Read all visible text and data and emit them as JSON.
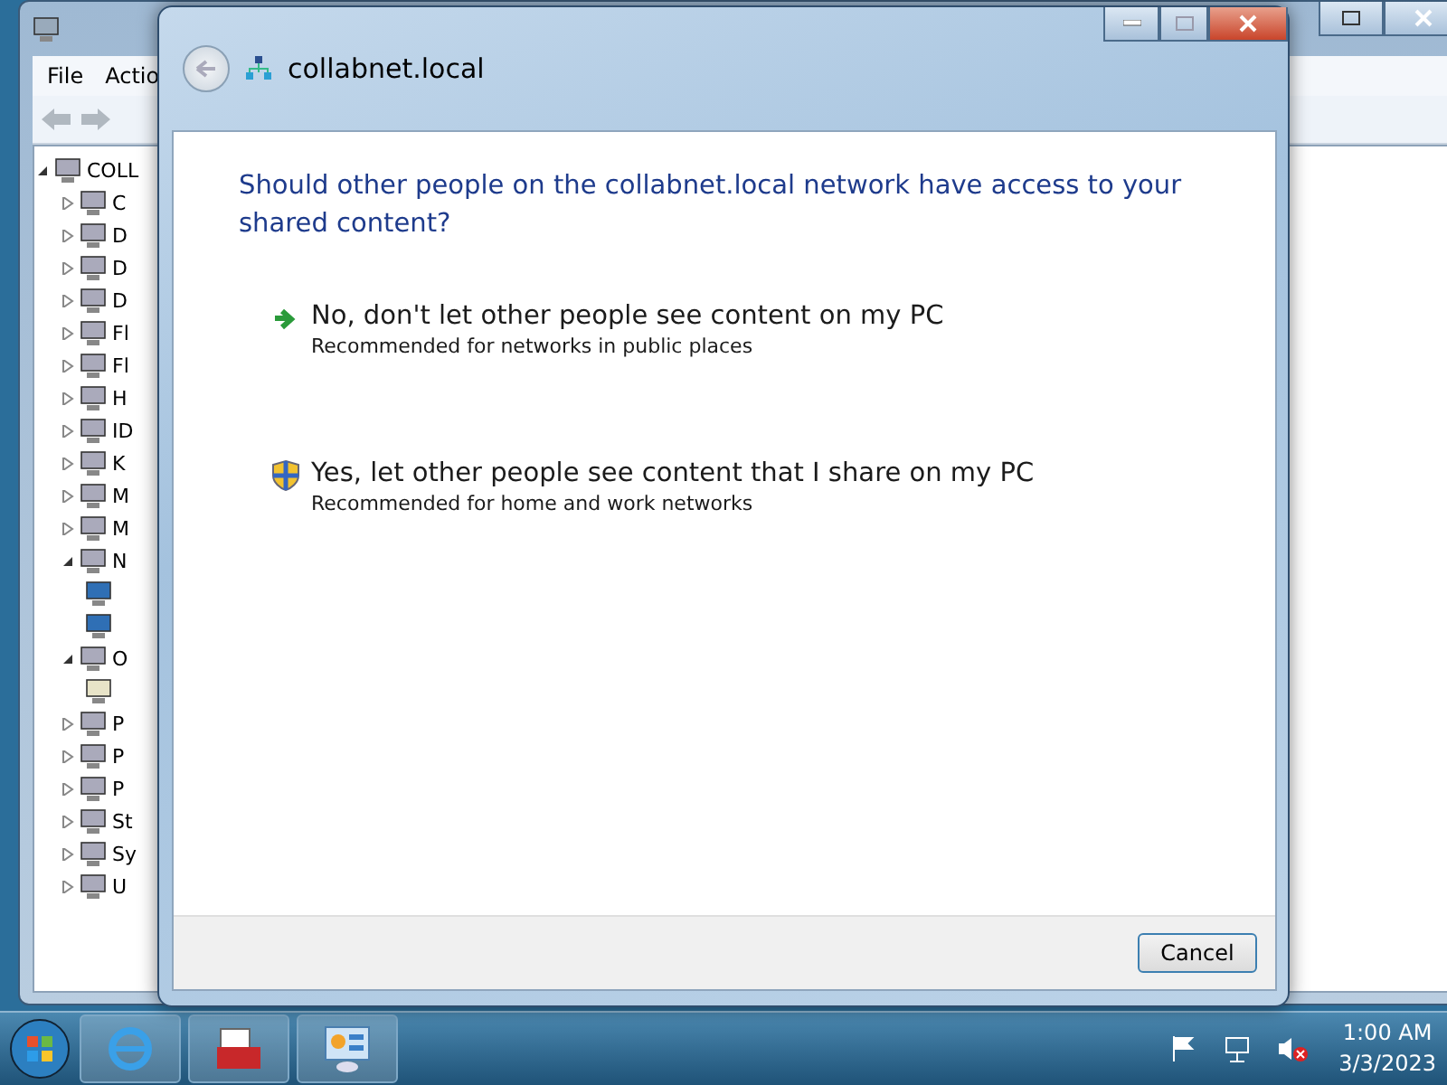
{
  "background_window": {
    "menu": [
      "File",
      "Actio"
    ],
    "tree": {
      "label": "COLL",
      "expanded": true,
      "children": [
        {
          "label": "C",
          "expanded": false
        },
        {
          "label": "D",
          "expanded": false
        },
        {
          "label": "D",
          "expanded": false
        },
        {
          "label": "D",
          "expanded": false
        },
        {
          "label": "Fl",
          "expanded": false
        },
        {
          "label": "Fl",
          "expanded": false
        },
        {
          "label": "H",
          "expanded": false
        },
        {
          "label": "ID",
          "expanded": false
        },
        {
          "label": "K",
          "expanded": false
        },
        {
          "label": "M",
          "expanded": false
        },
        {
          "label": "M",
          "expanded": false
        },
        {
          "label": "N",
          "expanded": true,
          "children": [
            {
              "kind": "adapter"
            },
            {
              "kind": "adapter"
            }
          ]
        },
        {
          "label": "O",
          "expanded": true,
          "children": [
            {
              "kind": "device"
            }
          ]
        },
        {
          "label": "P",
          "expanded": false
        },
        {
          "label": "P",
          "expanded": false
        },
        {
          "label": "P",
          "expanded": false
        },
        {
          "label": "St",
          "expanded": false
        },
        {
          "label": "Sy",
          "expanded": false
        },
        {
          "label": "U",
          "expanded": false
        }
      ]
    }
  },
  "dialog": {
    "title": "collabnet.local",
    "question": "Should other people on the collabnet.local network have access to your shared content?",
    "options": [
      {
        "kind": "arrow",
        "title": "No, don't let other people see content on my PC",
        "subtitle": "Recommended for networks in public places"
      },
      {
        "kind": "shield",
        "title": "Yes, let other people see content that I share on my PC",
        "subtitle": "Recommended for home and work networks"
      }
    ],
    "buttons": [
      "Cancel"
    ]
  },
  "taskbar": {
    "time": "1:00 AM",
    "date": "3/3/2023"
  }
}
